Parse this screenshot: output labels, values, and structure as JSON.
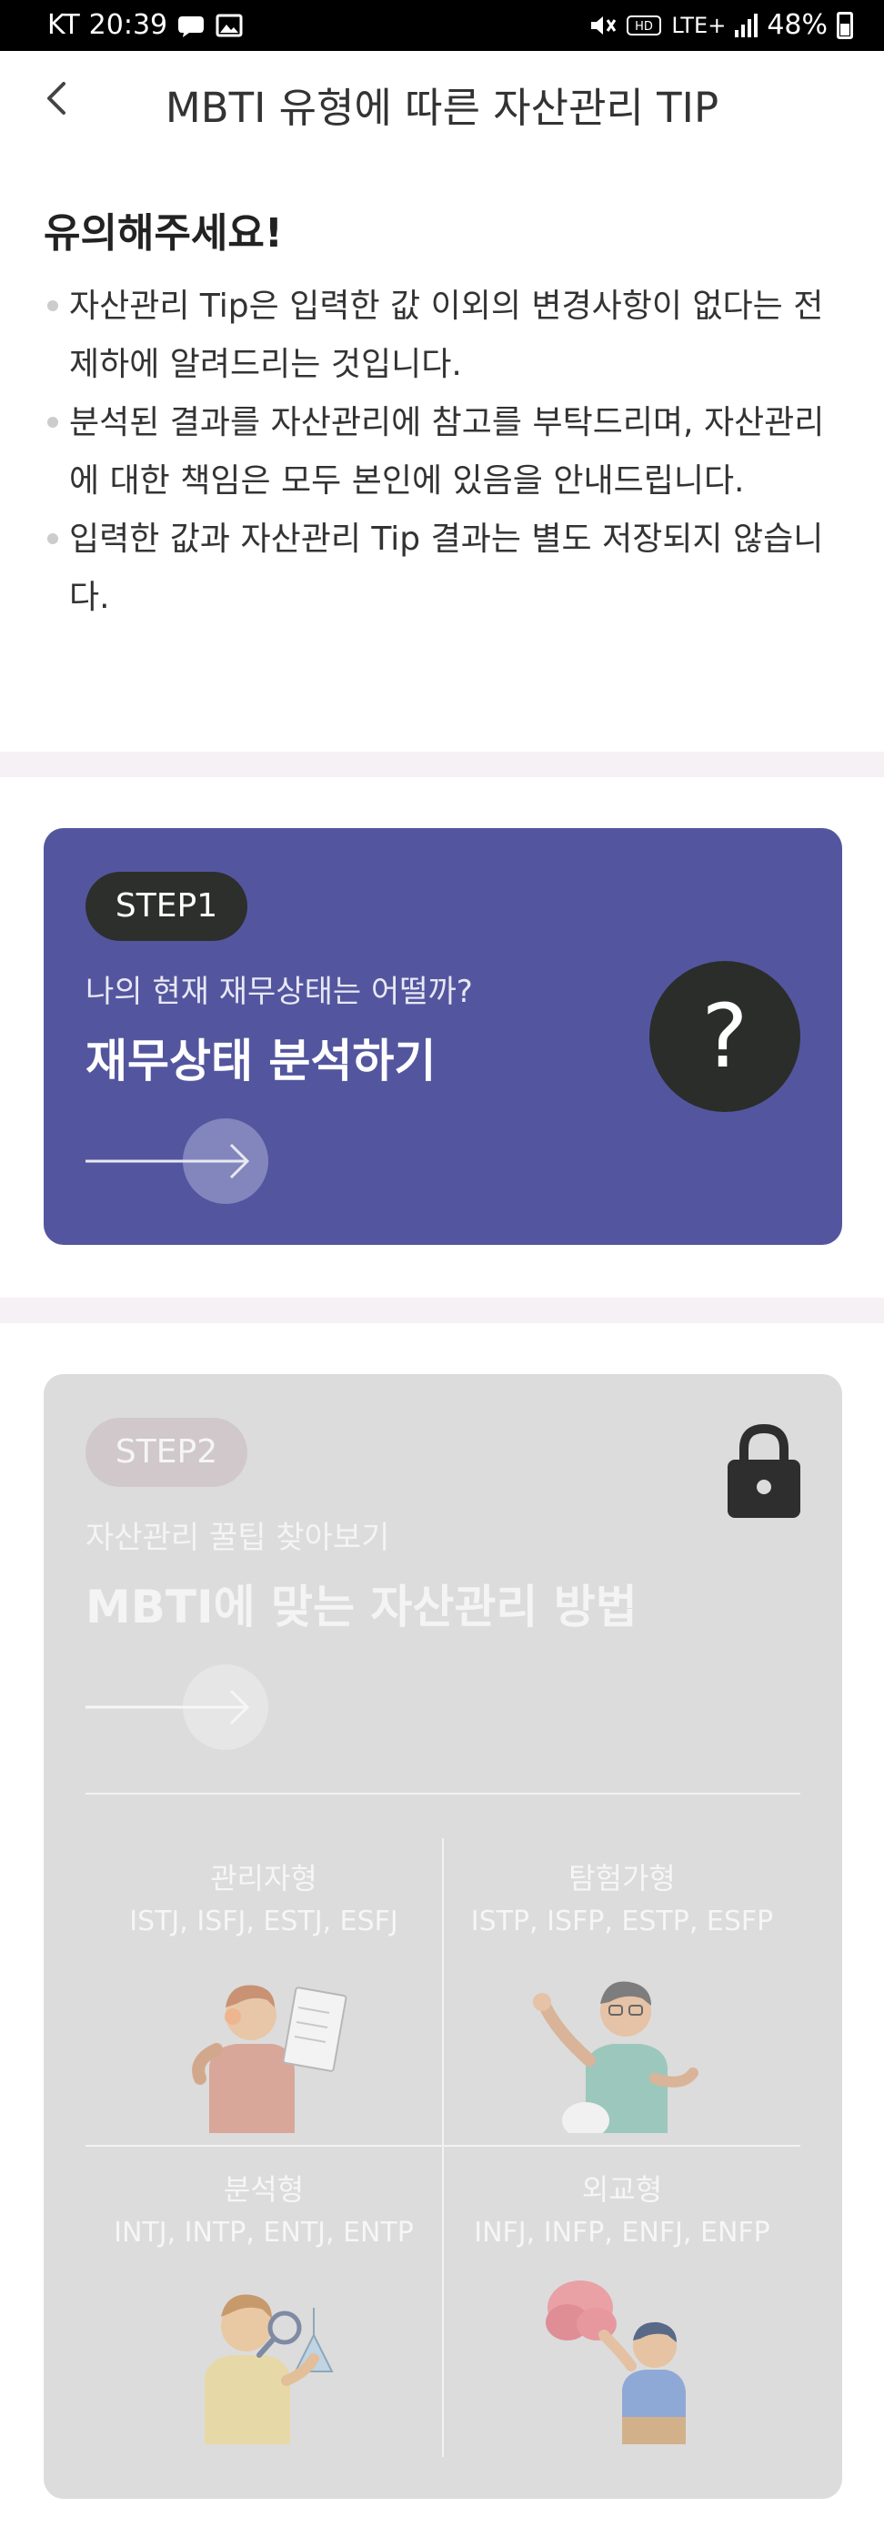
{
  "status_bar": {
    "carrier": "KT",
    "time": "20:39",
    "network": "LTE+",
    "battery": "48%"
  },
  "header": {
    "title": "MBTI 유형에 따른 자산관리 TIP"
  },
  "notice": {
    "title": "유의해주세요!",
    "items": [
      "자산관리 Tip은 입력한 값 이외의 변경사항이 없다는 전제하에 알려드리는 것입니다.",
      "분석된 결과를 자산관리에 참고를 부탁드리며, 자산관리에 대한 책임은 모두 본인에 있음을 안내드립니다.",
      "입력한 값과 자산관리 Tip 결과는 별도 저장되지 않습니다."
    ]
  },
  "step1": {
    "pill": "STEP1",
    "subtitle": "나의 현재 재무상태는 어떨까?",
    "title": "재무상태 분석하기",
    "badge": "?",
    "accent": "#53569e"
  },
  "step2": {
    "pill": "STEP2",
    "subtitle": "자산관리 꿀팁 찾아보기",
    "title": "MBTI에 맞는 자산관리 방법",
    "locked": true,
    "types": [
      {
        "name": "관리자형",
        "codes": "ISTJ, ISFJ, ESTJ, ESFJ"
      },
      {
        "name": "탐험가형",
        "codes": "ISTP, ISFP, ESTP, ESFP"
      },
      {
        "name": "분석형",
        "codes": "INTJ, INTP, ENTJ, ENTP"
      },
      {
        "name": "외교형",
        "codes": "INFJ, INFP, ENFJ, ENFP"
      }
    ]
  }
}
